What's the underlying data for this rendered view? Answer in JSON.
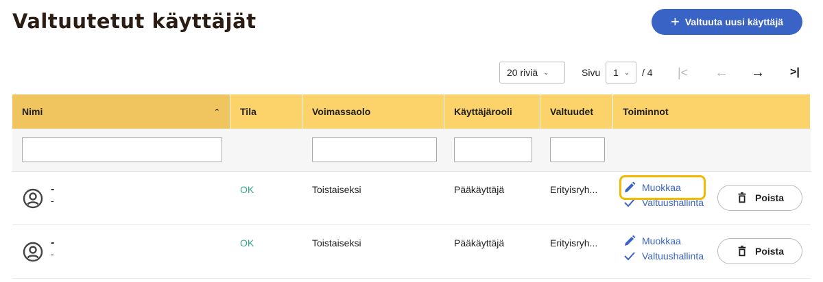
{
  "page": {
    "title": "Valtuutetut käyttäjät",
    "add_button_label": "Valtuuta uusi käyttäjä"
  },
  "pager": {
    "rows_option": "20 riviä",
    "page_label": "Sivu",
    "current_page": "1",
    "total_pages": "/ 4"
  },
  "table": {
    "columns": [
      "Nimi",
      "Tila",
      "Voimassaolo",
      "Käyttäjärooli",
      "Valtuudet",
      "Toiminnot"
    ],
    "rows": [
      {
        "name": "-",
        "sub": "-",
        "status": "OK",
        "validity": "Toistaiseksi",
        "role": "Pääkäyttäjä",
        "rights": "Erityisryh...",
        "edit": "Muokkaa",
        "manage": "Valtuushallinta",
        "delete": "Poista"
      },
      {
        "name": "-",
        "sub": "-",
        "status": "OK",
        "validity": "Toistaiseksi",
        "role": "Pääkäyttäjä",
        "rights": "Erityisryh...",
        "edit": "Muokkaa",
        "manage": "Valtuushallinta",
        "delete": "Poista"
      }
    ]
  },
  "icons": {
    "add": "plus-icon",
    "sort": "chevron-up-icon",
    "avatar": "user-circle-icon",
    "edit": "pencil-icon",
    "manage": "check-icon",
    "delete": "trash-icon"
  },
  "colors": {
    "accent": "#3a63c6",
    "header": "#fcd36a",
    "ok": "#36a58a",
    "highlight": "#f3b800"
  }
}
